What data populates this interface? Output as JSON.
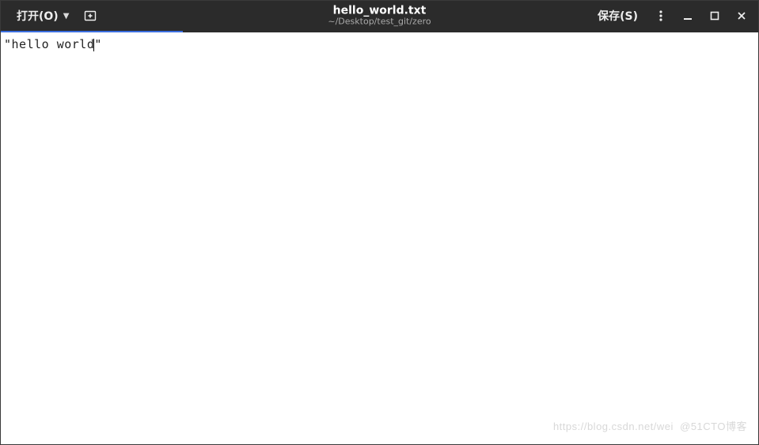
{
  "header": {
    "open_label": "打开(O)",
    "save_label": "保存(S)",
    "file_title": "hello_world.txt",
    "file_path": "~/Desktop/test_git/zero",
    "icons": {
      "open_dropdown": "chevron-down-icon",
      "new_tab": "new-tab-icon",
      "menu": "menu-dots-icon",
      "minimize": "minimize-icon",
      "maximize": "maximize-icon",
      "close": "close-icon"
    }
  },
  "editor": {
    "content": "\"hello world\"",
    "content_before_cursor": "\"hello world",
    "content_after_cursor": "\""
  },
  "watermark": "https://blog.csdn.net/wei  @51CTO博客"
}
